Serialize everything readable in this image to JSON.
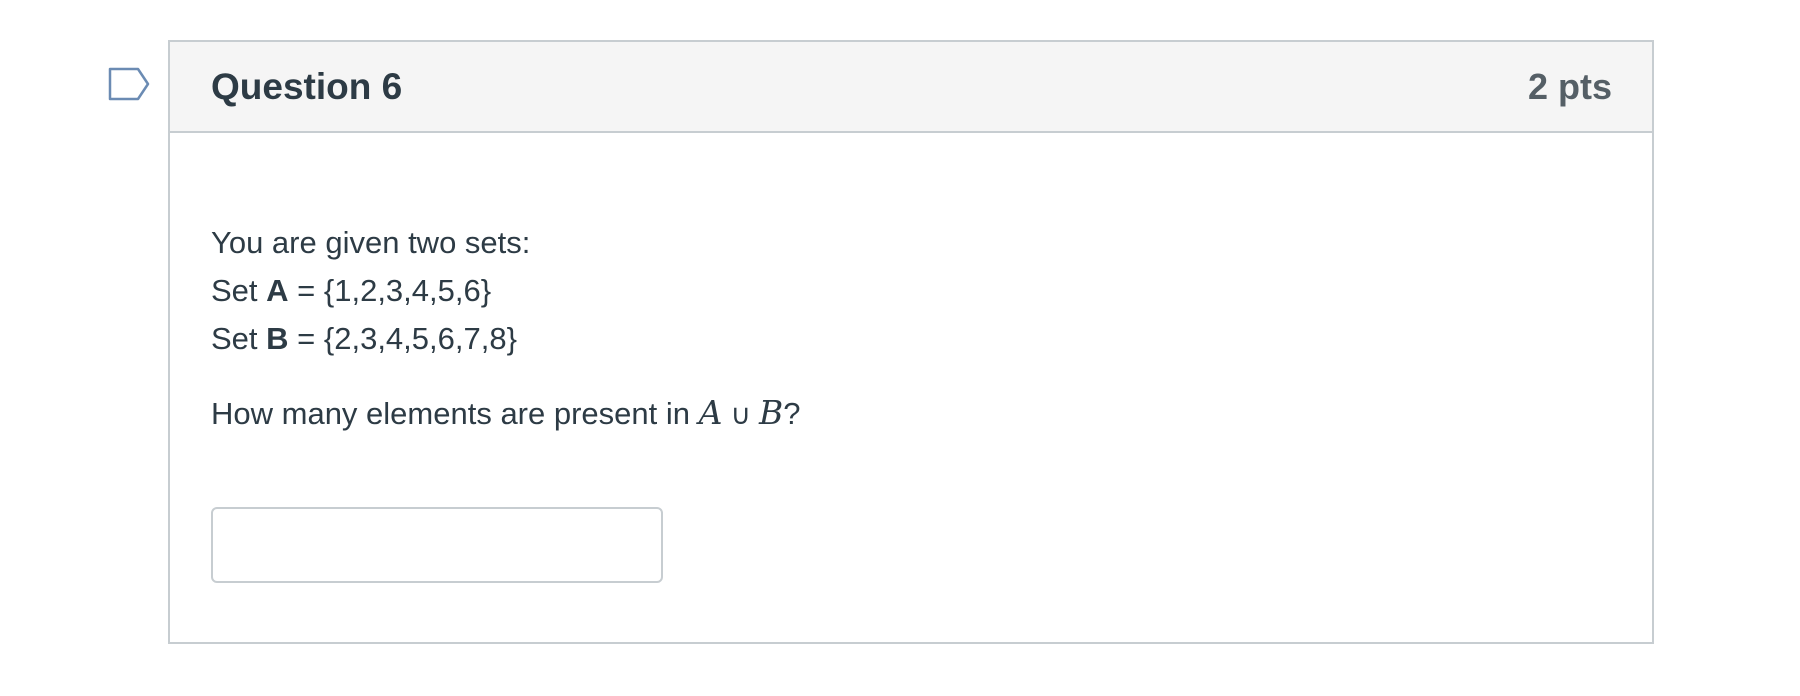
{
  "question": {
    "title": "Question 6",
    "points": "2 pts",
    "intro": "You are given two sets:",
    "set_a": {
      "prefix": "Set ",
      "name": "A",
      "value": " = {1,2,3,4,5,6}"
    },
    "set_b": {
      "prefix": "Set ",
      "name": "B",
      "value": " = {2,3,4,5,6,7,8}"
    },
    "prompt_text": "How many elements are present in ",
    "math": {
      "left": "A",
      "operator": "∪",
      "right": "B"
    },
    "prompt_end": "?",
    "answer": {
      "value": "",
      "placeholder": ""
    }
  },
  "colors": {
    "header_bg": "#f5f5f5",
    "border": "#c7cdd1",
    "text": "#2d3b45",
    "points_text": "#555f66",
    "flag_stroke": "#6b8bb3"
  },
  "icons": {
    "flag": "flag-question-icon"
  }
}
